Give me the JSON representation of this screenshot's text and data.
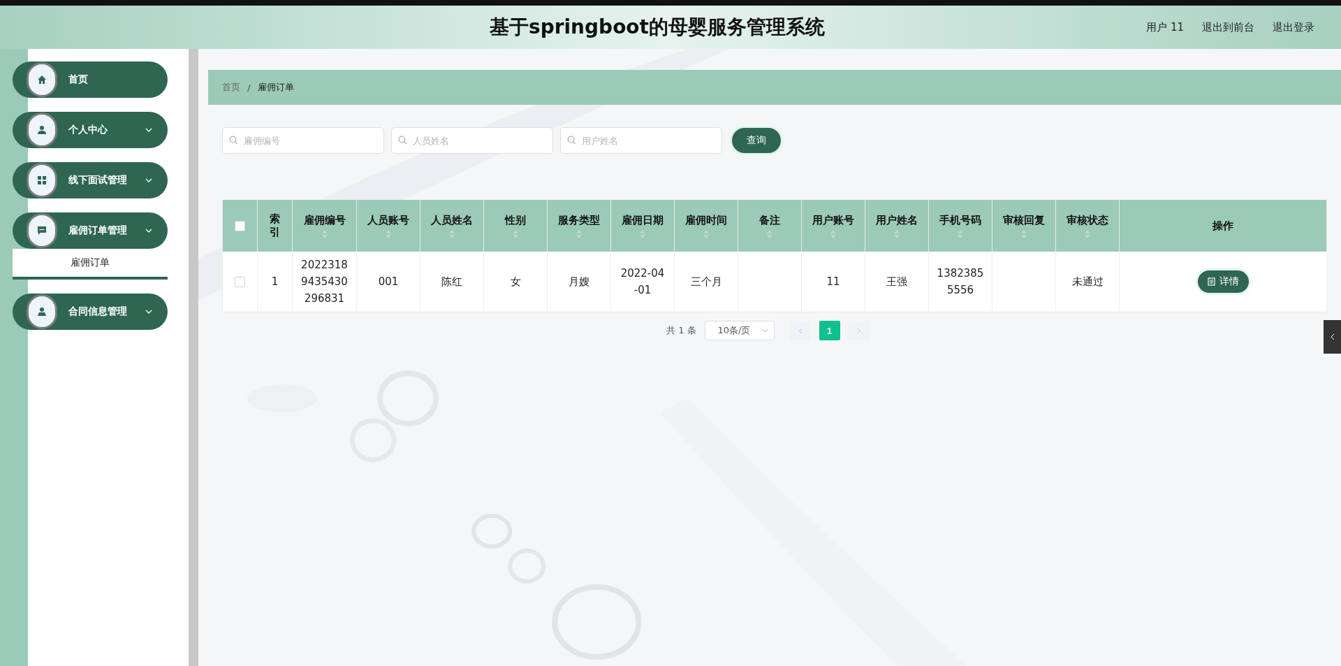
{
  "header": {
    "title": "基于springboot的母婴服务管理系统",
    "user": "用户 11",
    "links": [
      "退出到前台",
      "退出登录"
    ]
  },
  "sidebar": {
    "items": [
      {
        "label": "首页",
        "expandable": false
      },
      {
        "label": "个人中心",
        "expandable": true
      },
      {
        "label": "线下面试管理",
        "expandable": true
      },
      {
        "label": "雇佣订单管理",
        "expandable": true,
        "expanded": true,
        "children": [
          {
            "label": "雇佣订单",
            "selected": true
          }
        ]
      },
      {
        "label": "合同信息管理",
        "expandable": true
      }
    ]
  },
  "breadcrumb": [
    "首页",
    "/",
    "雇佣订单"
  ],
  "search": {
    "fields": [
      {
        "placeholder": "雇佣编号"
      },
      {
        "placeholder": "人员姓名"
      },
      {
        "placeholder": "用户姓名"
      }
    ],
    "button": "查询"
  },
  "table": {
    "columns": [
      {
        "label": "索引",
        "sortable": false
      },
      {
        "label": "雇佣编号",
        "sortable": true
      },
      {
        "label": "人员账号",
        "sortable": true
      },
      {
        "label": "人员姓名",
        "sortable": true
      },
      {
        "label": "性别",
        "sortable": true
      },
      {
        "label": "服务类型",
        "sortable": true
      },
      {
        "label": "雇佣日期",
        "sortable": true
      },
      {
        "label": "雇佣时间",
        "sortable": true
      },
      {
        "label": "备注",
        "sortable": true
      },
      {
        "label": "用户账号",
        "sortable": true
      },
      {
        "label": "用户姓名",
        "sortable": true
      },
      {
        "label": "手机号码",
        "sortable": true
      },
      {
        "label": "审核回复",
        "sortable": true
      },
      {
        "label": "审核状态",
        "sortable": true
      },
      {
        "label": "操作",
        "sortable": false
      }
    ],
    "all_checked": false,
    "rows": [
      {
        "checked": false,
        "cells": [
          "1",
          "20223189435430296831",
          "001",
          "陈红",
          "女",
          "月嫂",
          "2022-04-01",
          "三个月",
          "",
          "11",
          "王强",
          "13823855556",
          "",
          "未通过"
        ],
        "action": "详情"
      }
    ]
  },
  "pagination": {
    "total": "共 1 条",
    "page_size": "10条/页",
    "pages": [
      {
        "label": "1",
        "selected": true
      }
    ]
  }
}
